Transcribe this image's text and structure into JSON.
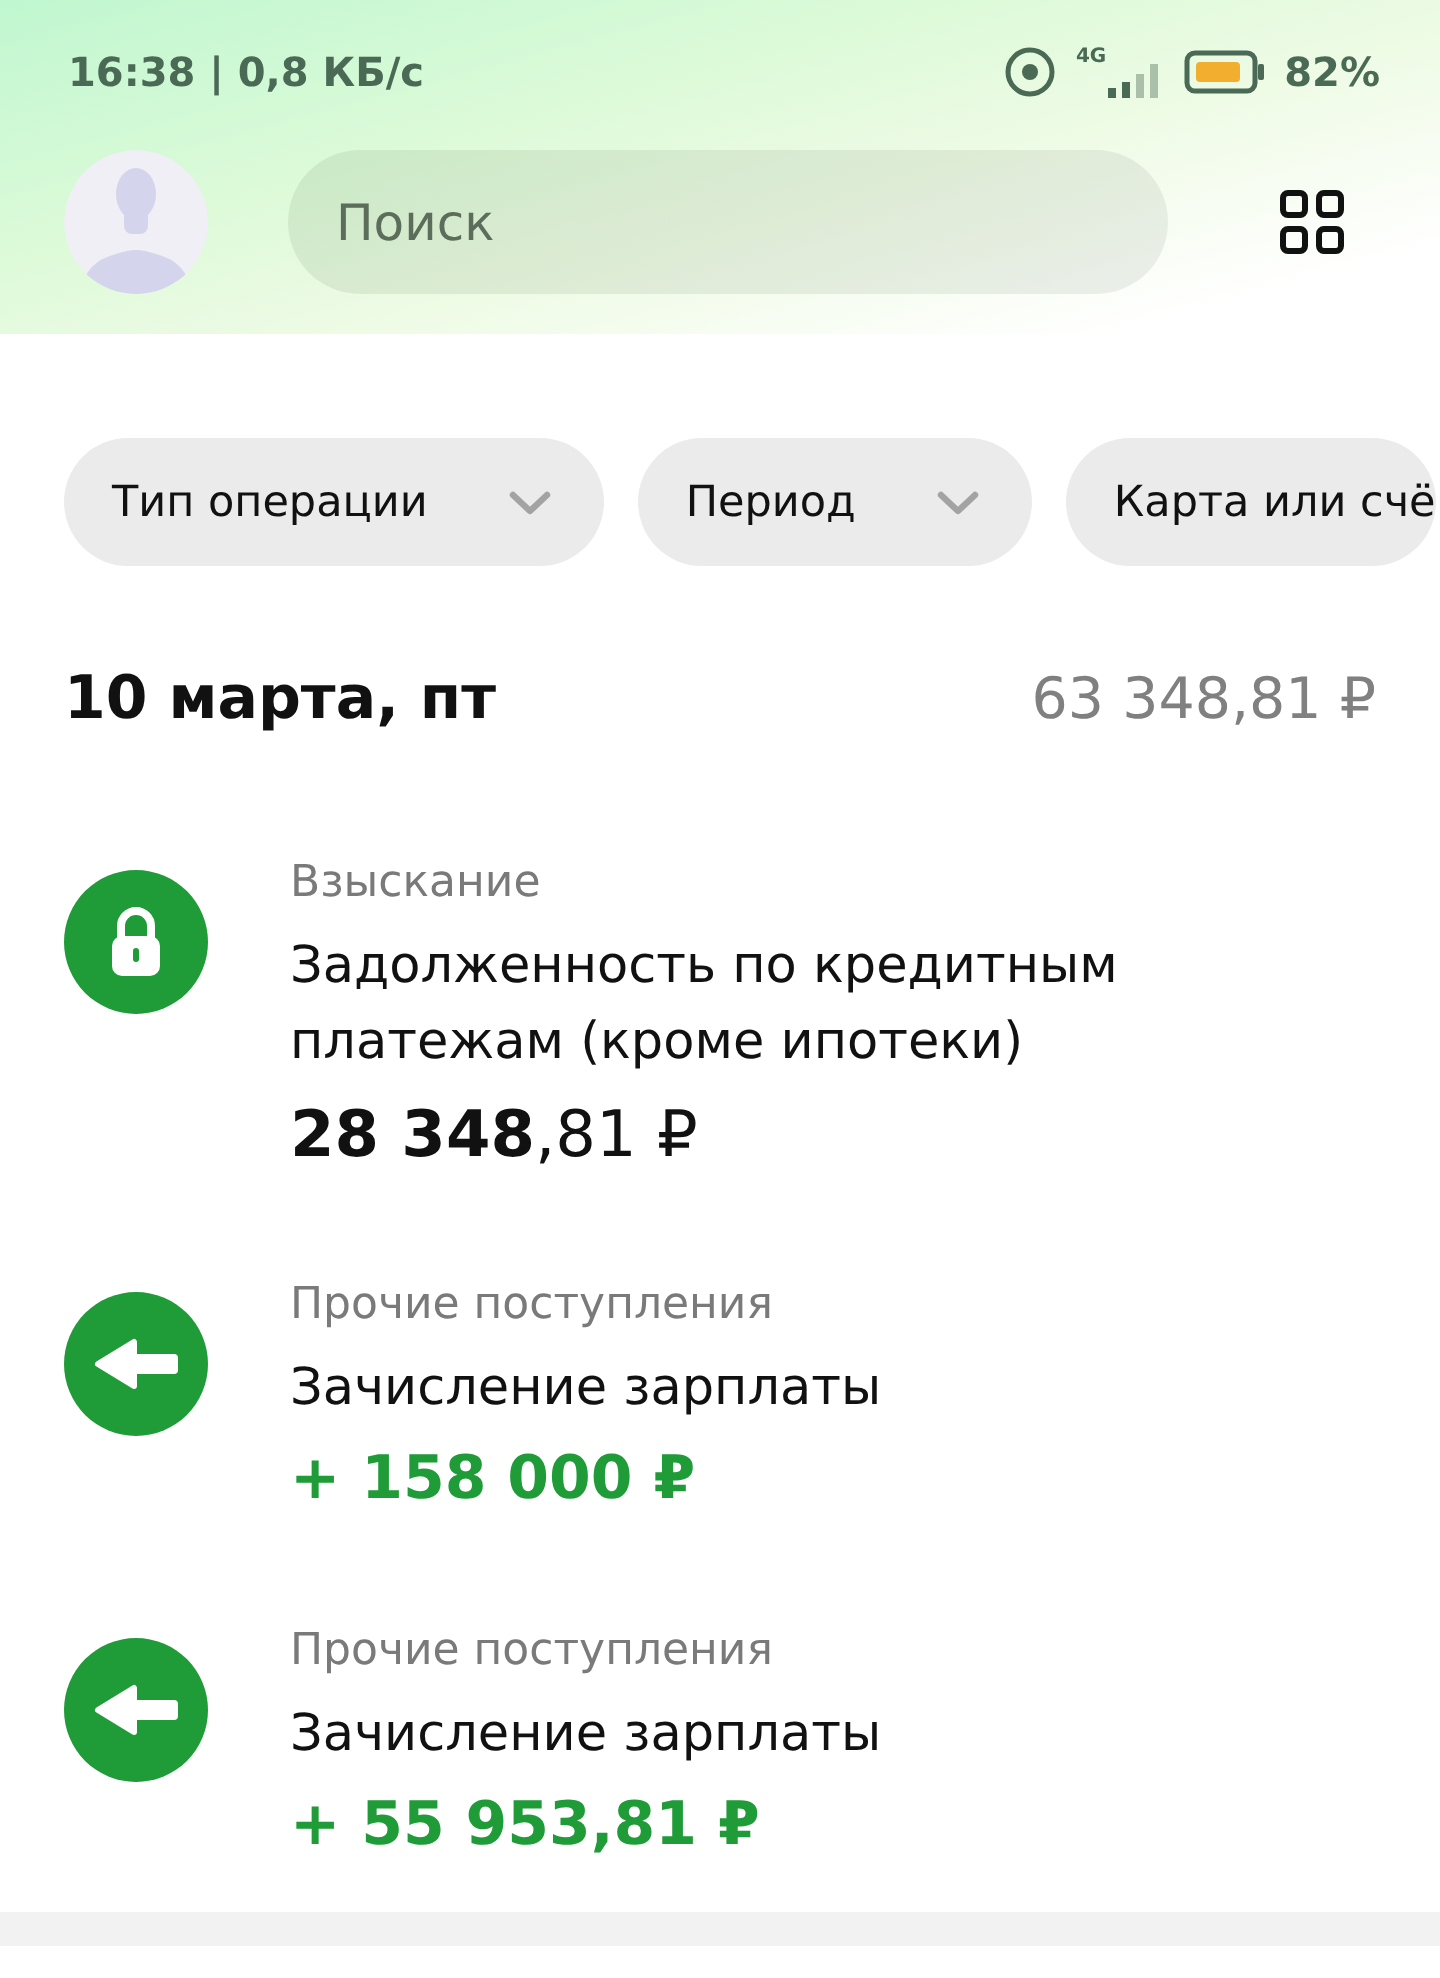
{
  "status_bar": {
    "time": "16:38 | 0,8 КБ/с",
    "network_label": "4G",
    "battery_percent": "82%"
  },
  "search": {
    "placeholder": "Поиск"
  },
  "filters": [
    {
      "label": "Тип операции",
      "has_dropdown": true
    },
    {
      "label": "Период",
      "has_dropdown": true
    },
    {
      "label": "Карта или счё",
      "has_dropdown": false
    }
  ],
  "day": {
    "date": "10 марта, пт",
    "total": "63 348,81 ₽"
  },
  "operations": [
    {
      "kind": "debit",
      "category": "Взыскание",
      "title": "Задолженность по кредитным платежам (кроме ипотеки)",
      "amount": "**28 348**,81 ₽"
    },
    {
      "kind": "income",
      "category": "Прочие поступления",
      "title": "Зачисление зарплаты",
      "amount": "+ 158 000 ₽"
    },
    {
      "kind": "income",
      "category": "Прочие поступления",
      "title": "Зачисление зарплаты",
      "amount": "+ 55 953,81 ₽"
    }
  ]
}
